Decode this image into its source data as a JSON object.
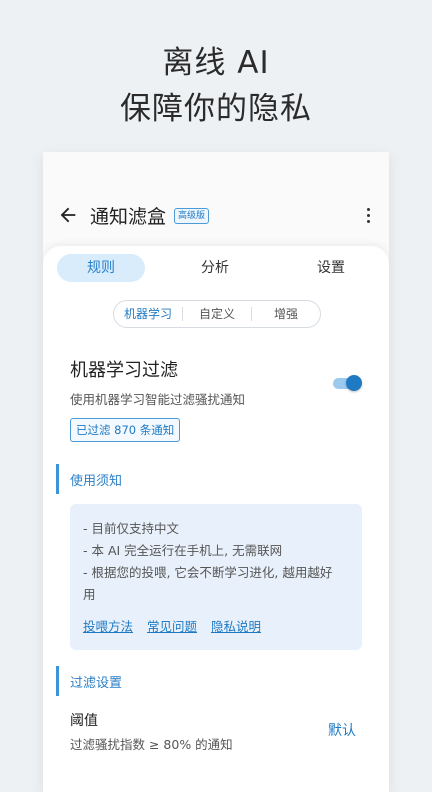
{
  "promo": {
    "line1": "离线 AI",
    "line2": "保障你的隐私"
  },
  "appbar": {
    "title": "通知滤盒",
    "badge": "高级版",
    "back_icon": "arrow-left-icon",
    "more_icon": "more-vertical-icon"
  },
  "tabs": [
    {
      "label": "规则",
      "active": true
    },
    {
      "label": "分析",
      "active": false
    },
    {
      "label": "设置",
      "active": false
    }
  ],
  "segments": [
    {
      "label": "机器学习",
      "active": true
    },
    {
      "label": "自定义",
      "active": false
    },
    {
      "label": "增强",
      "active": false
    }
  ],
  "feature": {
    "title": "机器学习过滤",
    "description": "使用机器学习智能过滤骚扰通知",
    "enabled": true,
    "count_text": "已过滤 870 条通知"
  },
  "notice": {
    "heading": "使用须知",
    "items": [
      "- 目前仅支持中文",
      "- 本 AI 完全运行在手机上, 无需联网",
      "- 根据您的投喂, 它会不断学习进化, 越用越好",
      "用"
    ],
    "links": [
      "投喂方法",
      "常见问题",
      "隐私说明"
    ]
  },
  "filter_settings": {
    "heading": "过滤设置",
    "threshold_label": "阈值",
    "threshold_desc": "过滤骚扰指数 ≥ 80% 的通知",
    "action": "默认"
  },
  "colors": {
    "accent": "#1f7ac4",
    "tab_active_bg": "#d9ecfb",
    "notice_bg": "#e8f1fb",
    "page_bg": "#eef1f4"
  }
}
